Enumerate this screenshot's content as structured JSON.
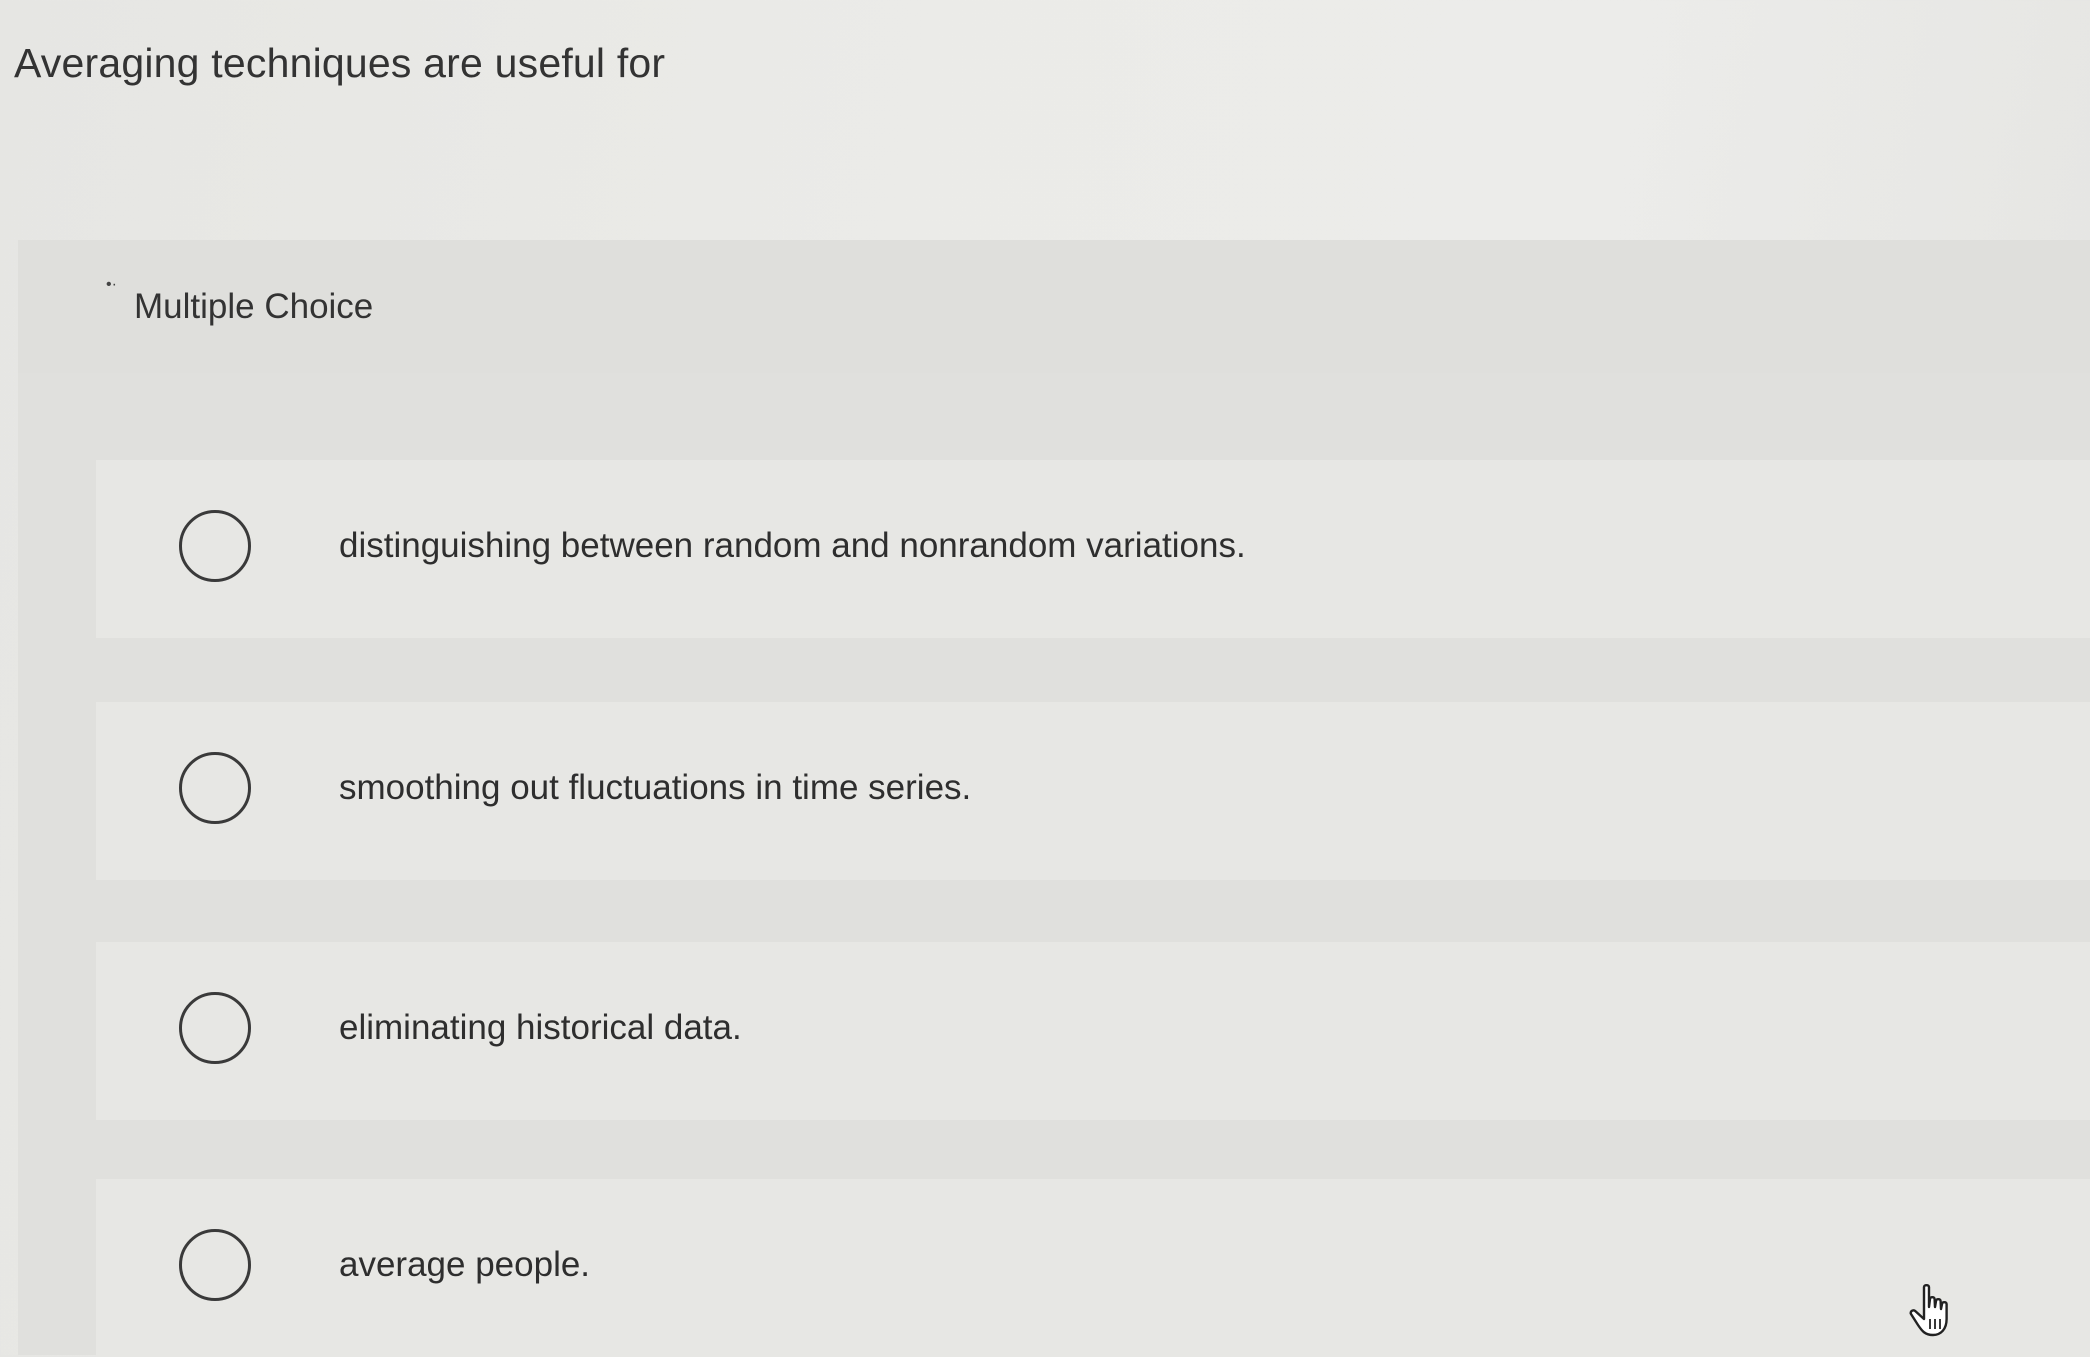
{
  "question": {
    "prompt": "Averaging techniques are useful for"
  },
  "question_type": {
    "label": "Multiple Choice"
  },
  "options": [
    {
      "text": "distinguishing between random and nonrandom variations.",
      "selected": false
    },
    {
      "text": "smoothing out fluctuations in time series.",
      "selected": false
    },
    {
      "text": "eliminating historical data.",
      "selected": false
    },
    {
      "text": "average people.",
      "selected": false
    }
  ],
  "cursor": {
    "icon": "hand-pointer-icon"
  }
}
